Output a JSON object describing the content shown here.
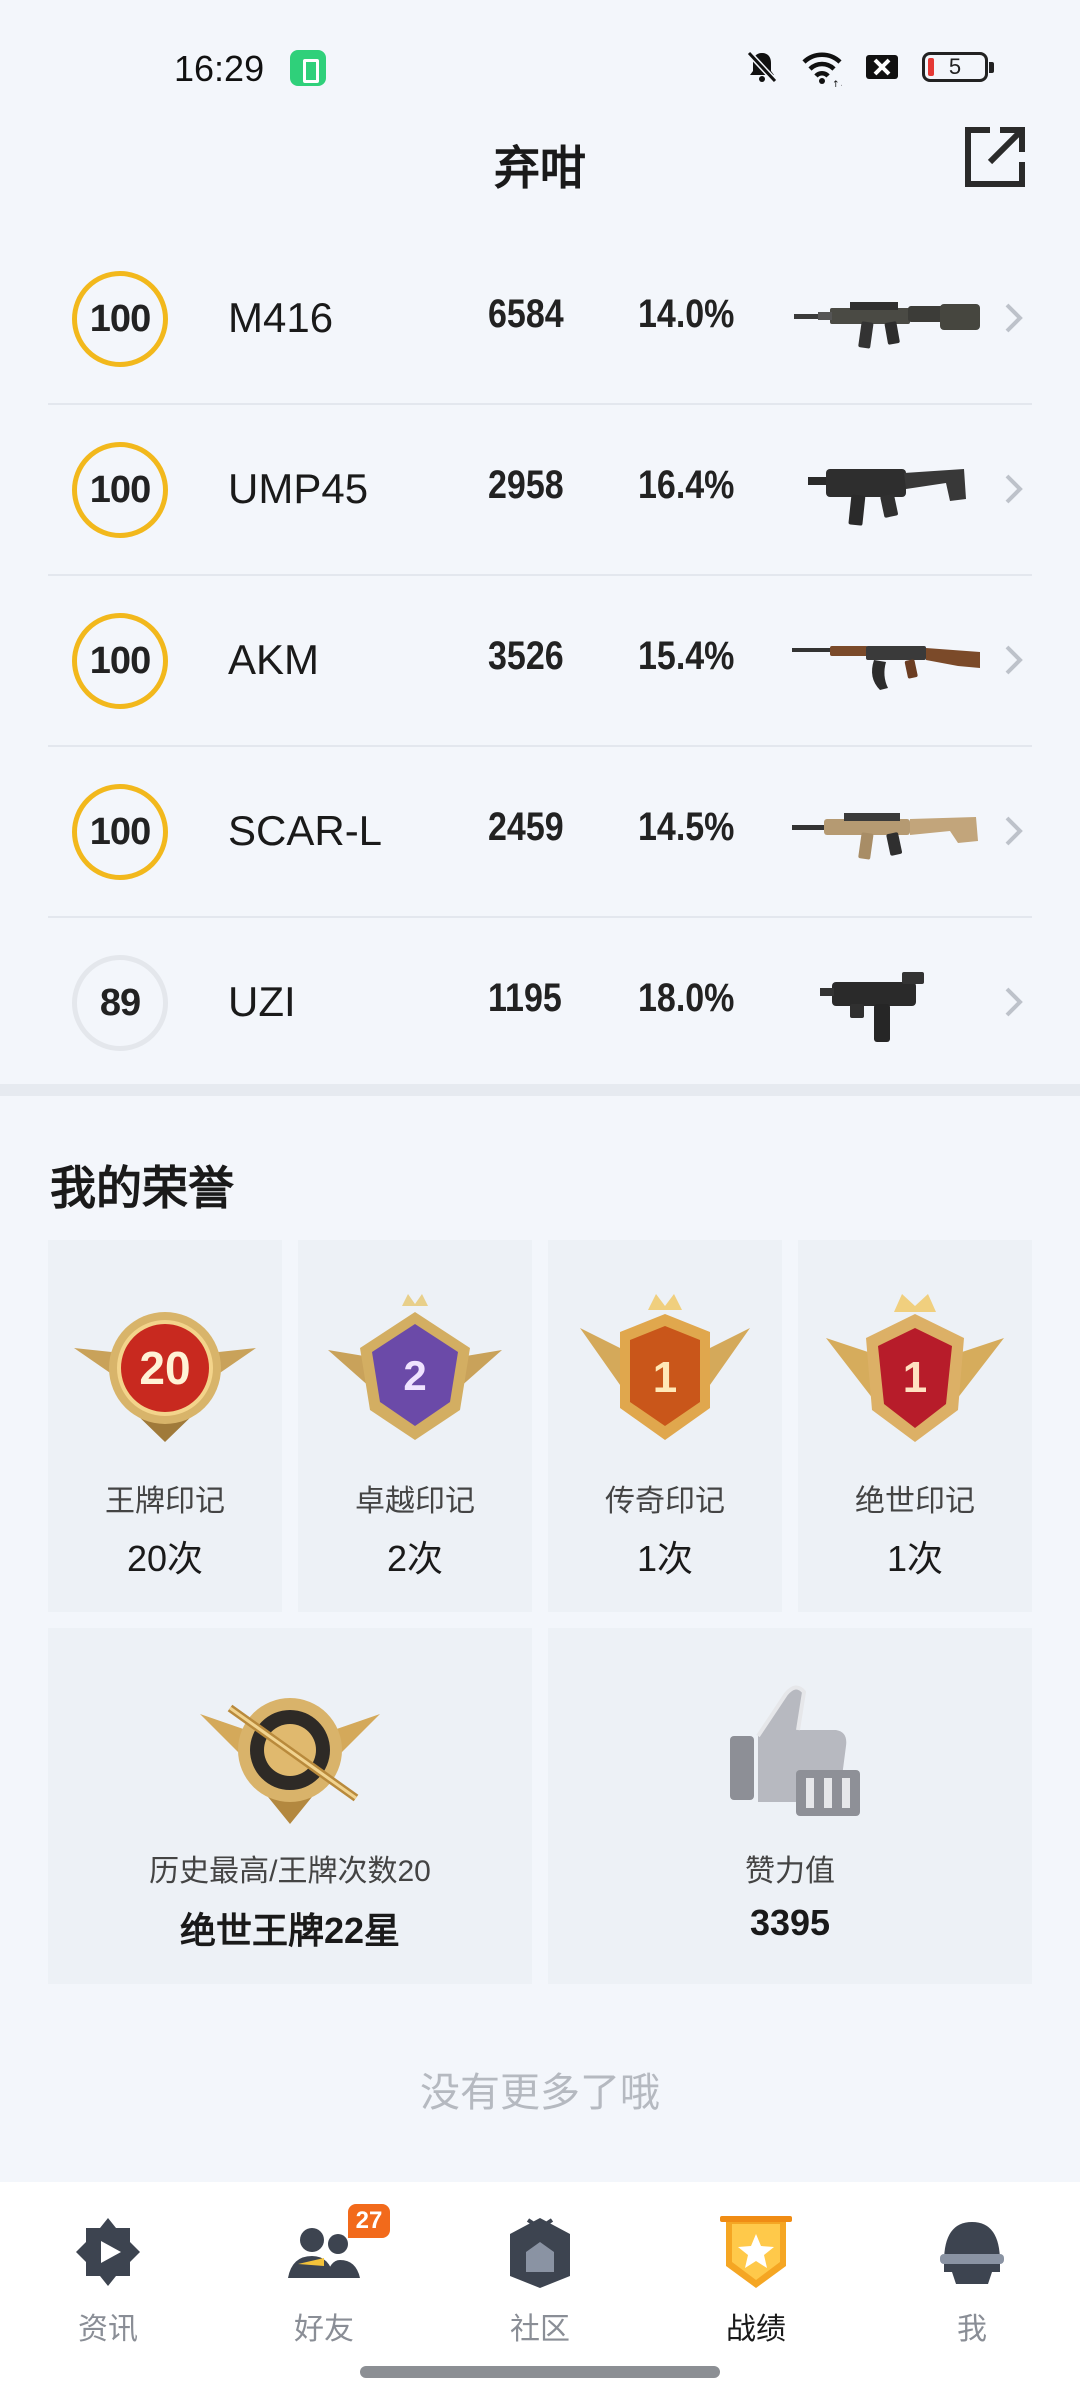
{
  "status_bar": {
    "time": "16:29",
    "battery_level": "5",
    "icons": [
      "battery-saver-app-icon",
      "bell-muted-icon",
      "wifi-icon",
      "no-sim-icon",
      "battery-icon"
    ]
  },
  "header": {
    "title": "弃咁",
    "share_icon": "share-external-icon"
  },
  "weapons": [
    {
      "mastery": "100",
      "name": "M416",
      "kills": "6584",
      "rate": "14.0%",
      "image": "rifle-m416"
    },
    {
      "mastery": "100",
      "name": "UMP45",
      "kills": "2958",
      "rate": "16.4%",
      "image": "smg-ump45"
    },
    {
      "mastery": "100",
      "name": "AKM",
      "kills": "3526",
      "rate": "15.4%",
      "image": "rifle-akm"
    },
    {
      "mastery": "100",
      "name": "SCAR-L",
      "kills": "2459",
      "rate": "14.5%",
      "image": "rifle-scar-l"
    },
    {
      "mastery": "89",
      "name": "UZI",
      "kills": "1195",
      "rate": "18.0%",
      "image": "smg-uzi"
    }
  ],
  "honors": {
    "title": "我的荣誉",
    "marks": [
      {
        "badge_number": "20",
        "label": "王牌印记",
        "value": "20次"
      },
      {
        "badge_number": "2",
        "label": "卓越印记",
        "value": "2次"
      },
      {
        "badge_number": "1",
        "label": "传奇印记",
        "value": "1次"
      },
      {
        "badge_number": "1",
        "label": "绝世印记",
        "value": "1次"
      }
    ],
    "highest": {
      "label": "历史最高/王牌次数20",
      "value": "绝世王牌22星"
    },
    "likes": {
      "label": "赞力值",
      "value": "3395"
    }
  },
  "no_more_text": "没有更多了哦",
  "tabs": [
    {
      "label": "资讯",
      "icon": "news-play-icon",
      "active": false
    },
    {
      "label": "好友",
      "icon": "friends-icon",
      "badge": "27",
      "active": false
    },
    {
      "label": "社区",
      "icon": "community-house-icon",
      "active": false
    },
    {
      "label": "战绩",
      "icon": "record-badge-icon",
      "active": true
    },
    {
      "label": "我",
      "icon": "helmet-profile-icon",
      "active": false
    }
  ],
  "colors": {
    "mastery_ring_full": "#f2b81c",
    "mastery_ring_partial": "#e4e7ec",
    "tab_badge": "#f26a1b",
    "active_tab_icon": "#f5a623"
  }
}
